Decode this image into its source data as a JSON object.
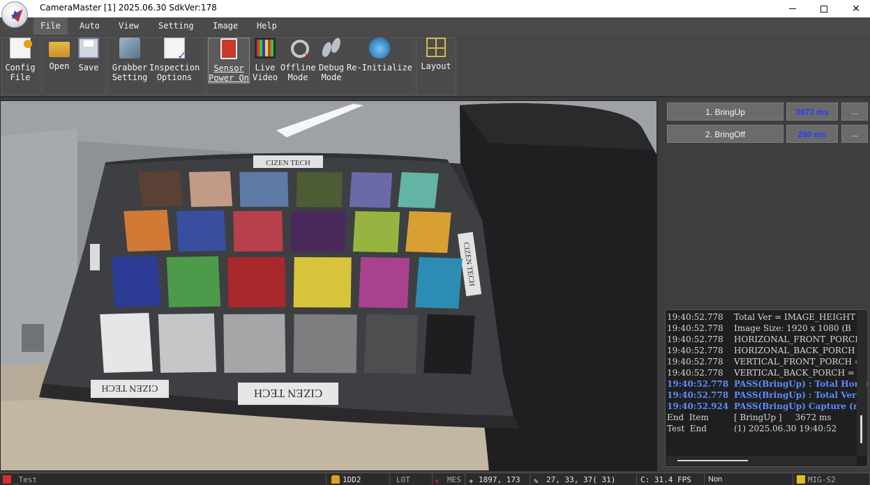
{
  "window": {
    "title": "CameraMaster [1] 2025.06.30 SdkVer:178",
    "controls": {
      "minimize": "minimize-icon",
      "maximize": "maximize-icon",
      "close": "✕"
    }
  },
  "menu": [
    "File",
    "Auto",
    "View",
    "Setting",
    "Image",
    "Help"
  ],
  "toolbar": {
    "config": "Config\nFile",
    "open": "Open",
    "save": "Save",
    "grabber": "Grabber\nSetting",
    "inspection": "Inspection\nOptions",
    "sensor": "Sensor\nPower On",
    "live": "Live\nVideo",
    "offline": "Offline\nMode",
    "debug": "Debug\nMode",
    "reinit": "Re-Initialize",
    "layout": "Layout"
  },
  "scene": {
    "chart_label_top": "CIZEN TECH",
    "chart_label_side": "CIZEN TECH",
    "chart_label_bottom_left": "CIZEN TECH",
    "chart_label_bottom_right": "CIZEN TECH",
    "patch_colors": [
      [
        "#5b4035",
        "#c39a86",
        "#5f7aa6",
        "#4e5c35",
        "#6b6aa8",
        "#64b4a6"
      ],
      [
        "#d07a35",
        "#3a4ea0",
        "#b8404c",
        "#4a2a5c",
        "#98b440",
        "#d8a032"
      ],
      [
        "#2c3c94",
        "#4d9a4a",
        "#a8282c",
        "#d8c43a",
        "#a8428e",
        "#2d8cb4"
      ],
      [
        "#e6e6e6",
        "#c4c6c8",
        "#a4a6a8",
        "#7c7e80",
        "#4c4e50",
        "#1e1e20"
      ]
    ]
  },
  "steps": [
    {
      "name": "1. BringUp",
      "time": "3672 ms",
      "more": "..."
    },
    {
      "name": "2. BringOff",
      "time": "290 ms",
      "more": "..."
    }
  ],
  "log": [
    {
      "ts": "19:40:52.778",
      "msg": "Total Ver = IMAGE_HEIGHT",
      "type": "normal"
    },
    {
      "ts": "19:40:52.778",
      "msg": "Image Size: 1920 x 1080 (B",
      "type": "normal"
    },
    {
      "ts": "19:40:52.778",
      "msg": "HORIZONAL_FRONT_PORCH",
      "type": "normal"
    },
    {
      "ts": "19:40:52.778",
      "msg": "HORIZONAL_BACK_PORCH =",
      "type": "normal"
    },
    {
      "ts": "19:40:52.778",
      "msg": "VERTICAL_FRONT_PORCH =",
      "type": "normal"
    },
    {
      "ts": "19:40:52.778",
      "msg": "VERTICAL_BACK_PORCH = (",
      "type": "normal"
    },
    {
      "ts": "19:40:52.778",
      "msg": "PASS(BringUp) : Total Hor =",
      "type": "pass"
    },
    {
      "ts": "19:40:52.778",
      "msg": "PASS(BringUp) : Total Ver =",
      "type": "pass"
    },
    {
      "ts": "19:40:52.924",
      "msg": "PASS(BringUp) Capture (nR",
      "type": "pass"
    },
    {
      "ts": "End  Item",
      "msg": "[ BringUp ]     3672 ms",
      "type": "normal"
    },
    {
      "ts": "Test  End",
      "msg": "(1) 2025.06.30 19:40:52",
      "type": "normal"
    }
  ],
  "status": {
    "test": "_Test",
    "lock": "1DD2",
    "lot": "LOT",
    "mes": "MES",
    "coord": "1897, 173",
    "pixel": "27, 33, 37( 31)",
    "fps": "C: 31.4 FPS",
    "non": "Non",
    "board": "MIG-S2"
  }
}
